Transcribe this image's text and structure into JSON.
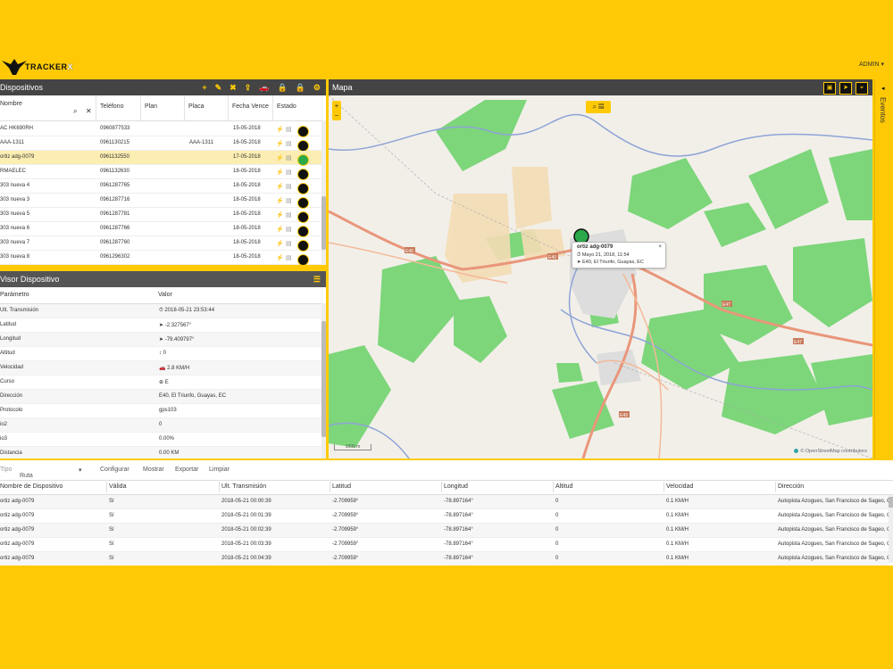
{
  "app": {
    "brand": "TRACKER",
    "brand_x": "X",
    "user": "ADMIN ▾"
  },
  "devices": {
    "title": "Dispositivos",
    "tools": [
      "+",
      "✎",
      "✖",
      "⇪",
      "🚗",
      "🔒",
      "🔒",
      "⚙"
    ],
    "columns": [
      "Nombre",
      "Teléfono",
      "Plan",
      "Placa",
      "Fecha Vence",
      "Estado"
    ],
    "rows": [
      {
        "name": "AC HK690RH",
        "phone": "0960877533",
        "plan": "",
        "plate": "",
        "date": "15-05-2018",
        "icon": "black"
      },
      {
        "name": "AAA-1311",
        "phone": "0961130215",
        "plan": "",
        "plate": "AAA-1311",
        "date": "16-05-2018",
        "icon": "black"
      },
      {
        "name": "ortiz adg-0079",
        "phone": "0961132550",
        "plan": "",
        "plate": "",
        "date": "17-05-2018",
        "icon": "green"
      },
      {
        "name": "RMAELEC",
        "phone": "0961132630",
        "plan": "",
        "plate": "",
        "date": "18-05-2018",
        "icon": "black"
      },
      {
        "name": "303 nueva 4",
        "phone": "0961287765",
        "plan": "",
        "plate": "",
        "date": "18-05-2018",
        "icon": "black"
      },
      {
        "name": "303 nueva 3",
        "phone": "0961287716",
        "plan": "",
        "plate": "",
        "date": "18-05-2018",
        "icon": "black"
      },
      {
        "name": "303 nueva 5",
        "phone": "0961287781",
        "plan": "",
        "plate": "",
        "date": "18-05-2018",
        "icon": "black"
      },
      {
        "name": "303 nueva 6",
        "phone": "0961287766",
        "plan": "",
        "plate": "",
        "date": "18-05-2018",
        "icon": "black"
      },
      {
        "name": "303 nueva 7",
        "phone": "0961287760",
        "plan": "",
        "plate": "",
        "date": "18-05-2018",
        "icon": "black"
      },
      {
        "name": "303 nueva 8",
        "phone": "0961296302",
        "plan": "",
        "plate": "",
        "date": "18-05-2018",
        "icon": "black"
      }
    ]
  },
  "viewer": {
    "title": "Visor Dispositivo",
    "col_param": "Parámetro",
    "col_value": "Valor",
    "rows": [
      {
        "k": "Ult. Transmisión",
        "v": "⏱ 2018-05-21 23:53:44"
      },
      {
        "k": "Latitud",
        "v": "➤ -2.327567°"
      },
      {
        "k": "Longitud",
        "v": "➤ -79.409797°"
      },
      {
        "k": "Altitud",
        "v": "↕ 0"
      },
      {
        "k": "Velocidad",
        "v": "🚗 2.8 KM/H"
      },
      {
        "k": "Curso",
        "v": "⊕ E"
      },
      {
        "k": "Dirección",
        "v": "E40, El Triunfo, Guayas, EC"
      },
      {
        "k": "Protocolo",
        "v": "gps103"
      },
      {
        "k": "io2",
        "v": "0"
      },
      {
        "k": "io3",
        "v": "0.00%"
      },
      {
        "k": "Distancia",
        "v": "0.00 KM"
      }
    ]
  },
  "map": {
    "title": "Mapa",
    "popup": {
      "name": "ortiz adg-0079",
      "line2": "⏱ Mayo 21, 2018, 11:54",
      "line3": "➤ E40, El Triunfo, Guayas, EC",
      "close": "×"
    },
    "scale": "1000 m",
    "attribution": "© OpenStreetMap contributors",
    "roads": [
      "E40",
      "E40",
      "E47",
      "E47",
      "E49"
    ]
  },
  "events": {
    "label": "Eventos",
    "arrow": "◂"
  },
  "history": {
    "tipo_label": "Tipo",
    "tipo_value": "Ruta",
    "actions": [
      "Configurar",
      "Mostrar",
      "Exportar",
      "Limpiar"
    ],
    "columns": [
      "Nombre de Dispositivo",
      "Válida",
      "Ult. Transmisión",
      "Latitud",
      "Longitud",
      "Altitud",
      "Velocidad",
      "Dirección"
    ],
    "rows": [
      [
        "ortiz adg-0079",
        "Sí",
        "2018-05-21 00:00:39",
        "-2.709959°",
        "-78.897164°",
        "0",
        "0.1 KM/H",
        "Autopista Azogues, San Francisco de Sageo, C..."
      ],
      [
        "ortiz adg-0079",
        "Sí",
        "2018-05-21 00:01:39",
        "-2.709959°",
        "-78.897164°",
        "0",
        "0.1 KM/H",
        "Autopista Azogues, San Francisco de Sageo, C..."
      ],
      [
        "ortiz adg-0079",
        "Sí",
        "2018-05-21 00:02:39",
        "-2.709959°",
        "-78.897164°",
        "0",
        "0.1 KM/H",
        "Autopista Azogues, San Francisco de Sageo, C..."
      ],
      [
        "ortiz adg-0079",
        "Sí",
        "2018-05-21 00:03:39",
        "-2.709959°",
        "-78.897164°",
        "0",
        "0.1 KM/H",
        "Autopista Azogues, San Francisco de Sageo, C..."
      ],
      [
        "ortiz adg-0079",
        "Sí",
        "2018-05-21 00:04:39",
        "-2.709959°",
        "-78.897164°",
        "0",
        "0.1 KM/H",
        "Autopista Azogues, San Francisco de Sageo, C..."
      ]
    ]
  },
  "colors": {
    "accent": "#FFCA05",
    "bar": "#444444",
    "online": "#2BA84A",
    "park": "#7DD67A",
    "road": "#E9967A",
    "river": "#8EA4D6"
  }
}
